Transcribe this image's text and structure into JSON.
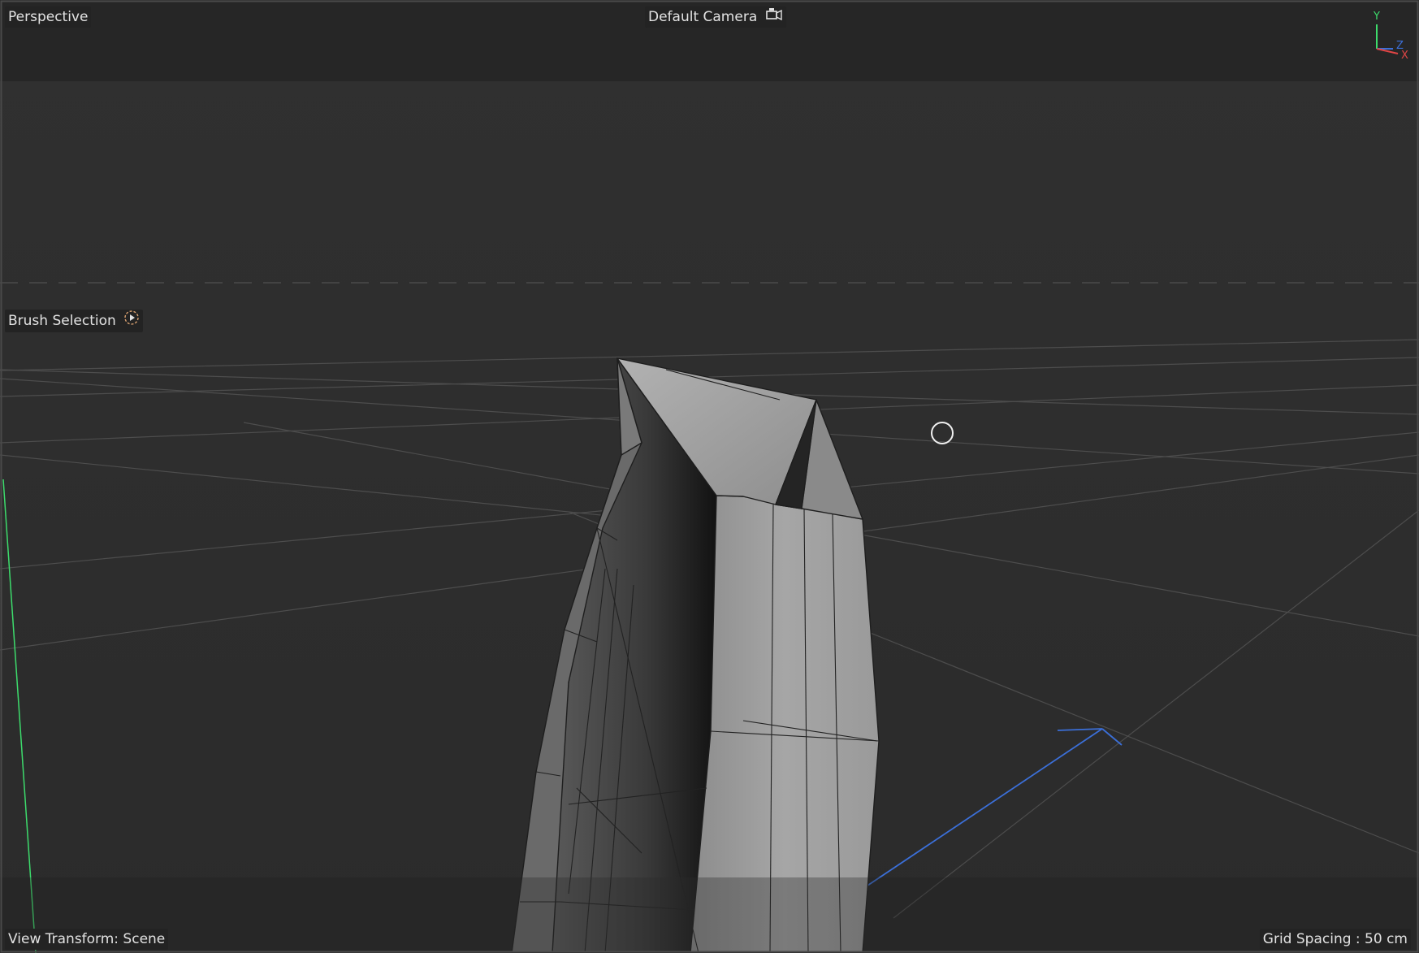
{
  "viewport": {
    "mode_label": "Perspective",
    "camera_label": "Default Camera",
    "tool_label": "Brush Selection",
    "view_transform": "View Transform: Scene",
    "grid_spacing": "Grid Spacing : 50 cm"
  },
  "axis_gizmo": {
    "y": "Y",
    "z": "Z",
    "x": "X"
  },
  "icons": {
    "camera": "camera-icon",
    "tool_options": "tool-options-icon",
    "cursor": "brush-cursor-circle"
  },
  "colors": {
    "viewport_bg": "#2d2d2d",
    "header_bar": "#262626",
    "y_axis": "#3ddc6c",
    "z_axis": "#3b6fd8",
    "x_axis": "#e04545"
  }
}
